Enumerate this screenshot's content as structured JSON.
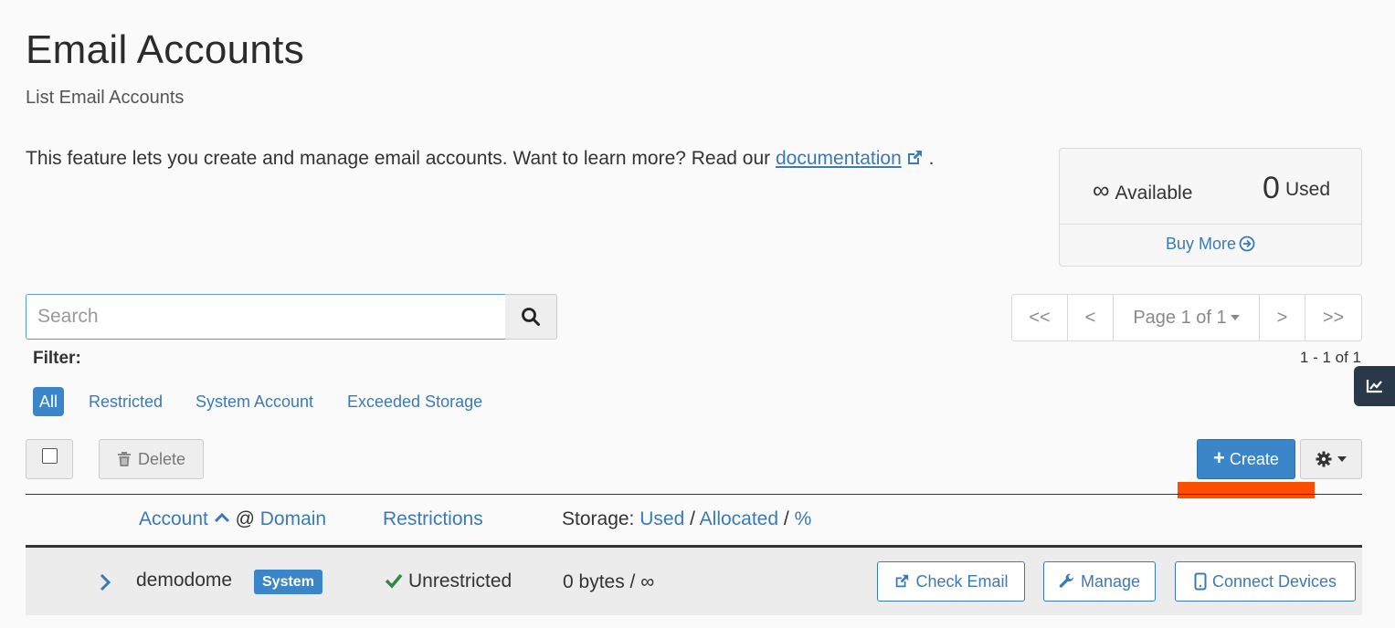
{
  "header": {
    "title": "Email Accounts",
    "subtitle": "List Email Accounts"
  },
  "intro": {
    "text": "This feature lets you create and manage email accounts. Want to learn more? Read our",
    "link": "documentation",
    "trailing": "."
  },
  "stats": {
    "available_symbol": "∞",
    "available_label": "Available",
    "used_count": "0",
    "used_label": "Used",
    "buy_more": "Buy More"
  },
  "search": {
    "placeholder": "Search",
    "value": ""
  },
  "pagination": {
    "first": "<<",
    "prev": "<",
    "page_label": "Page 1 of 1",
    "next": ">",
    "last": ">>",
    "result_count": "1 - 1 of 1"
  },
  "filter": {
    "label": "Filter:",
    "options": [
      "All",
      "Restricted",
      "System Account",
      "Exceeded Storage"
    ],
    "selected": "All"
  },
  "toolbar": {
    "delete_label": "Delete",
    "create_label": "Create"
  },
  "table": {
    "columns": {
      "account": "Account",
      "at": "@",
      "domain": "Domain",
      "restrictions": "Restrictions",
      "storage_label": "Storage:",
      "storage_used": "Used",
      "storage_sep1": "/",
      "storage_allocated": "Allocated",
      "storage_sep2": "/",
      "storage_percent": "%"
    },
    "rows": [
      {
        "account": "demodome",
        "badge": "System",
        "restriction": "Unrestricted",
        "storage": "0 bytes / ∞",
        "actions": [
          "Check Email",
          "Manage",
          "Connect Devices"
        ]
      }
    ]
  },
  "colors": {
    "accent": "#3a86c8",
    "link": "#3a7ab8",
    "success": "#2e8b3e",
    "highlight": "#ff4d00",
    "side_tab": "#29394a"
  },
  "icons": {
    "external_link": "external-link-icon",
    "search": "search-icon",
    "arrow_circle_right": "arrow-circle-right-icon",
    "trash": "trash-icon",
    "gear": "gear-icon",
    "check": "check-icon",
    "wrench": "wrench-icon",
    "mobile": "mobile-icon",
    "chart": "line-chart-icon"
  }
}
